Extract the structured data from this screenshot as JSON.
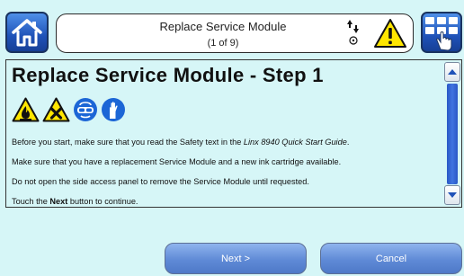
{
  "header": {
    "title": "Replace Service Module",
    "step_counter": "(1 of 9)",
    "icons": [
      "home-icon",
      "status-arrows-icon",
      "warning-icon",
      "menu-grid-icon"
    ]
  },
  "content": {
    "title": "Replace Service Module - Step 1",
    "hazard_icons": [
      "flammable-hazard-icon",
      "harmful-hazard-icon",
      "eye-protection-icon",
      "gloves-icon"
    ],
    "line1_prefix": "Before you start, make sure that you read the Safety text in the ",
    "line1_emphasis": "Linx 8940 Quick Start Guide",
    "line1_suffix": ".",
    "line2": "Make sure that you have a replacement Service Module and a new ink cartridge available.",
    "line3": "Do not open the side access panel to remove the Service Module until requested.",
    "line4_prefix": "Touch the ",
    "line4_bold": "Next",
    "line4_suffix": " button to continue."
  },
  "footer": {
    "next_label": "Next >",
    "cancel_label": "Cancel"
  },
  "colors": {
    "background": "#d6f6f7",
    "button_blue": "#1f52b8",
    "warning_yellow": "#ffe600",
    "safety_blue": "#1c66d6"
  }
}
